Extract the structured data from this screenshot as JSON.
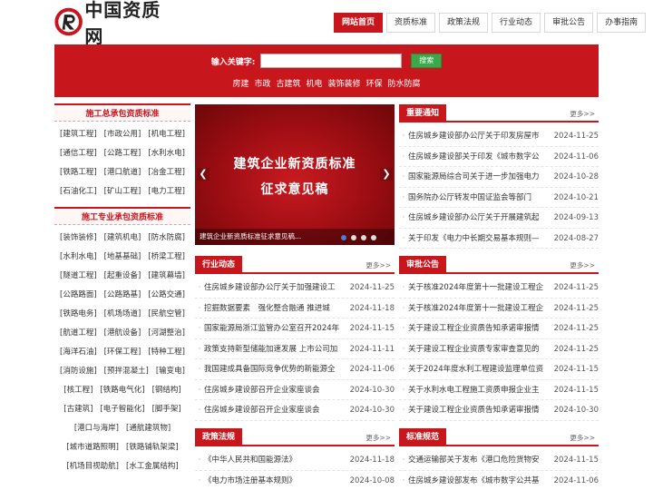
{
  "site": {
    "brand": "中国资质网"
  },
  "nav": [
    "网站首页",
    "资质标准",
    "政策法规",
    "行业动态",
    "审批公告",
    "办事指南"
  ],
  "search": {
    "label": "输入关键字:",
    "value": "",
    "button": "搜索",
    "hot": [
      "房建",
      "市政",
      "古建筑",
      "机电",
      "装饰装修",
      "环保",
      "防水防腐"
    ]
  },
  "left": [
    {
      "title": "施工总承包资质标准",
      "items": [
        "[建筑工程]",
        "[市政公用]",
        "[机电工程]",
        "[通信工程]",
        "[公路工程]",
        "[水利水电]",
        "[铁路工程]",
        "[港口航道]",
        "[冶金工程]",
        "[石油化工]",
        "[矿山工程]",
        "[电力工程]"
      ]
    },
    {
      "title": "施工专业承包资质标准",
      "items": [
        "[装饰装修]",
        "[建筑机电]",
        "[防水防腐]",
        "[水利水电]",
        "[地基基础]",
        "[桥梁工程]",
        "[隧道工程]",
        "[起重设备]",
        "[建筑幕墙]",
        "[公路路面]",
        "[公路路基]",
        "[公路交通]",
        "[铁路电务]",
        "[机场场道]",
        "[民航空管]",
        "[航道工程]",
        "[港航设备]",
        "[河湖整治]",
        "[海洋石油]",
        "[环保工程]",
        "[特种工程]",
        "[消防设施]",
        "[预拌混凝土]",
        "[输变电]",
        "[核工程]",
        "[铁路电气化]",
        "[钢结构]",
        "[古建筑]",
        "[电子智能化]",
        "[脚手架]",
        "[港口与海岸]",
        "[通航建筑物]",
        "[城市道路照明]",
        "[铁路铺轨架梁]",
        "[机场目视助航]",
        "[水工金属结构]"
      ]
    }
  ],
  "slider": {
    "line1": "建筑企业新资质标准",
    "line2": "征求意见稿",
    "caption": "建筑企业新资质标准征求意见稿..."
  },
  "more": "更多>>",
  "panels": {
    "notice": {
      "title": "重要通知",
      "items": [
        {
          "t": "住房城乡建设部办公厅关于印发房屋市",
          "d": "2024-11-25"
        },
        {
          "t": "住房城乡建设部关于印发《城市数字公",
          "d": "2024-11-06"
        },
        {
          "t": "国家能源局综合司关于进一步加强电力",
          "d": "2024-10-28"
        },
        {
          "t": "国务院办公厅转发中国证监会等部门",
          "d": "2024-10-21"
        },
        {
          "t": "住房城乡建设部办公厅关于开展建筑起",
          "d": "2024-09-13"
        },
        {
          "t": "关于印发《电力中长期交易基本规则—",
          "d": "2024-08-27"
        }
      ]
    },
    "industry": {
      "title": "行业动态",
      "items": [
        {
          "t": "住房城乡建设部办公厅关于加强建设工",
          "d": "2024-11-25"
        },
        {
          "t": "挖掘数据要素　强化整合融通 推进城",
          "d": "2024-11-18"
        },
        {
          "t": "国家能源局浙江监管办公室召开2024年",
          "d": "2024-11-15"
        },
        {
          "t": "政策支持新型储能加速发展 上市公司加",
          "d": "2024-11-11"
        },
        {
          "t": "我国建成具备国际竞争优势的新能源全",
          "d": "2024-11-06"
        },
        {
          "t": "住房城乡建设部召开企业家座谈会",
          "d": "2024-10-30"
        },
        {
          "t": "住房城乡建设部召开企业家座谈会",
          "d": "2024-10-30"
        }
      ]
    },
    "approval": {
      "title": "审批公告",
      "items": [
        {
          "t": "关于核准2024年度第十一批建设工程企",
          "d": "2024-11-25"
        },
        {
          "t": "关于核准2024年度第十一批建设工程企",
          "d": "2024-11-25"
        },
        {
          "t": "关于建设工程企业资质告知承诺审报情",
          "d": "2024-11-25"
        },
        {
          "t": "关于建设工程企业资质专家审查意见的",
          "d": "2024-11-25"
        },
        {
          "t": "关于2024年度水利工程建设监理单位资",
          "d": "2024-11-15"
        },
        {
          "t": "关于水利水电工程施工资质申报企业主",
          "d": "2024-11-15"
        },
        {
          "t": "关于建设工程企业资质告知承诺审报情",
          "d": "2024-10-30"
        }
      ]
    },
    "policy": {
      "title": "政策法规",
      "items": [
        {
          "t": "《中华人民共和国能源法》",
          "d": "2024-11-18"
        },
        {
          "t": "《电力市场注册基本规则》",
          "d": "2024-10-08"
        }
      ]
    },
    "standard": {
      "title": "标准规范",
      "items": [
        {
          "t": "交通运输部关于发布《港口危险货物安",
          "d": "2024-11-15"
        },
        {
          "t": "住房城乡建设部发布《城市数字公共基",
          "d": "2024-11-06"
        }
      ]
    }
  },
  "colors": {
    "accent": "#c8161d",
    "search_button": "#3aa94a",
    "dot_active": "#4a7fd0"
  }
}
